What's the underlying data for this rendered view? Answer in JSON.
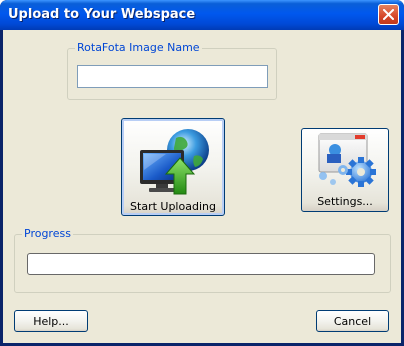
{
  "window": {
    "title": "Upload to Your Webspace"
  },
  "image_name_group": {
    "label": "RotaFota Image Name",
    "value": ""
  },
  "buttons": {
    "start_upload": "Start Uploading",
    "settings": "Settings...",
    "help": "Help...",
    "cancel": "Cancel"
  },
  "progress_group": {
    "label": "Progress",
    "progress_fraction": 0
  },
  "icons": {
    "start_upload": "monitor-globe-upload-icon",
    "settings": "settings-gears-icon",
    "close": "close-icon"
  },
  "colors": {
    "group_label": "#0046d5",
    "titlebar": "#0058ee",
    "close_button": "#d6472a",
    "window_background": "#ece9d8"
  }
}
